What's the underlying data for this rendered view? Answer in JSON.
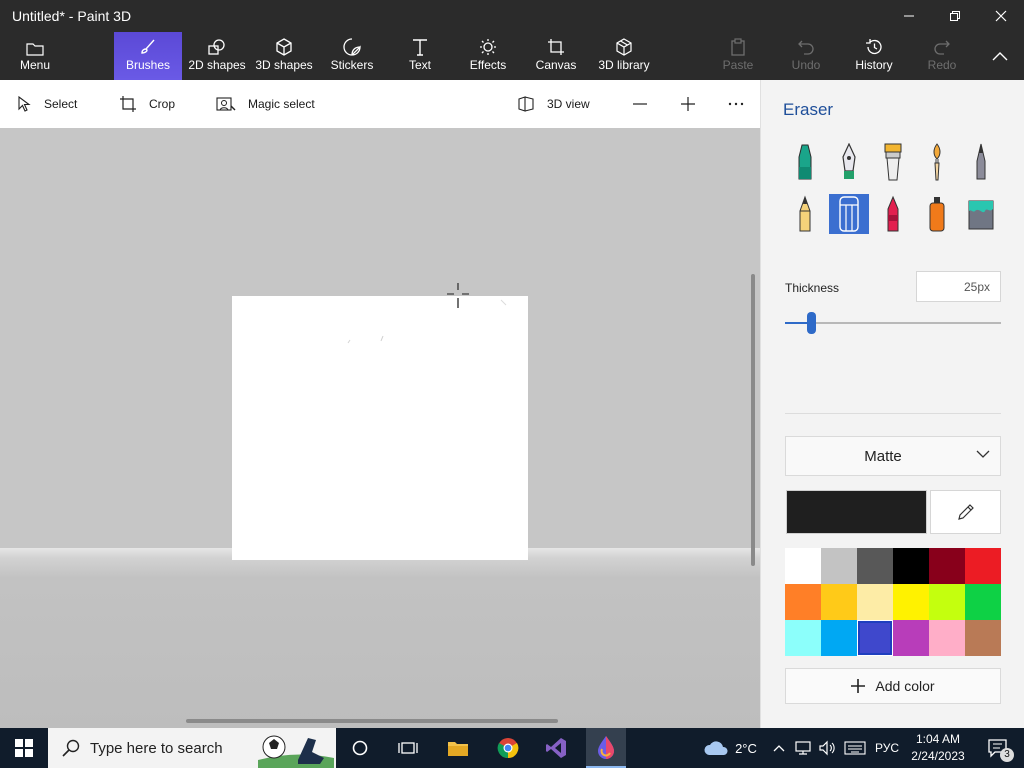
{
  "window": {
    "title": "Untitled* - Paint 3D",
    "controls": [
      "minimize",
      "restore",
      "close"
    ]
  },
  "ribbon": {
    "menu_label": "Menu",
    "tabs": [
      {
        "label": "Brushes",
        "icon": "brush-icon",
        "active": true
      },
      {
        "label": "2D shapes",
        "icon": "2d-shapes-icon"
      },
      {
        "label": "3D shapes",
        "icon": "3d-shapes-icon"
      },
      {
        "label": "Stickers",
        "icon": "stickers-icon"
      },
      {
        "label": "Text",
        "icon": "text-icon"
      },
      {
        "label": "Effects",
        "icon": "effects-icon"
      },
      {
        "label": "Canvas",
        "icon": "canvas-icon"
      },
      {
        "label": "3D library",
        "icon": "3d-library-icon"
      }
    ],
    "actions": [
      {
        "label": "Paste",
        "icon": "paste-icon",
        "enabled": false
      },
      {
        "label": "Undo",
        "icon": "undo-icon",
        "enabled": false
      },
      {
        "label": "History",
        "icon": "history-icon",
        "enabled": true
      },
      {
        "label": "Redo",
        "icon": "redo-icon",
        "enabled": false
      }
    ]
  },
  "toolbar": {
    "select_label": "Select",
    "crop_label": "Crop",
    "magic_select_label": "Magic select",
    "view3d_label": "3D view"
  },
  "panel": {
    "title": "Eraser",
    "brushes": [
      "marker",
      "calligraphy-pen",
      "oil-brush",
      "watercolor",
      "pixel-pen",
      "pencil",
      "eraser",
      "crayon",
      "spray-can",
      "fill"
    ],
    "selected_brush": "eraser",
    "thickness_label": "Thickness",
    "thickness_value": "25px",
    "thickness_fraction": 0.12,
    "finish": "Matte",
    "current_color": "#1f1f1f",
    "palette": [
      "#ffffff",
      "#c3c3c3",
      "#585858",
      "#000000",
      "#88001b",
      "#ec1c24",
      "#ff7f27",
      "#ffca18",
      "#fdeca6",
      "#fff200",
      "#c4ff0e",
      "#0ed145",
      "#8cfffb",
      "#00a8f3",
      "#3f48cc",
      "#b83dba",
      "#ffaec8",
      "#b97a56"
    ],
    "selected_swatch": 14,
    "add_color_label": "Add color"
  },
  "taskbar": {
    "search_placeholder": "Type here to search",
    "weather": "2°C",
    "language": "РУС",
    "time": "1:04 AM",
    "date": "2/24/2023",
    "notifications": "3"
  }
}
